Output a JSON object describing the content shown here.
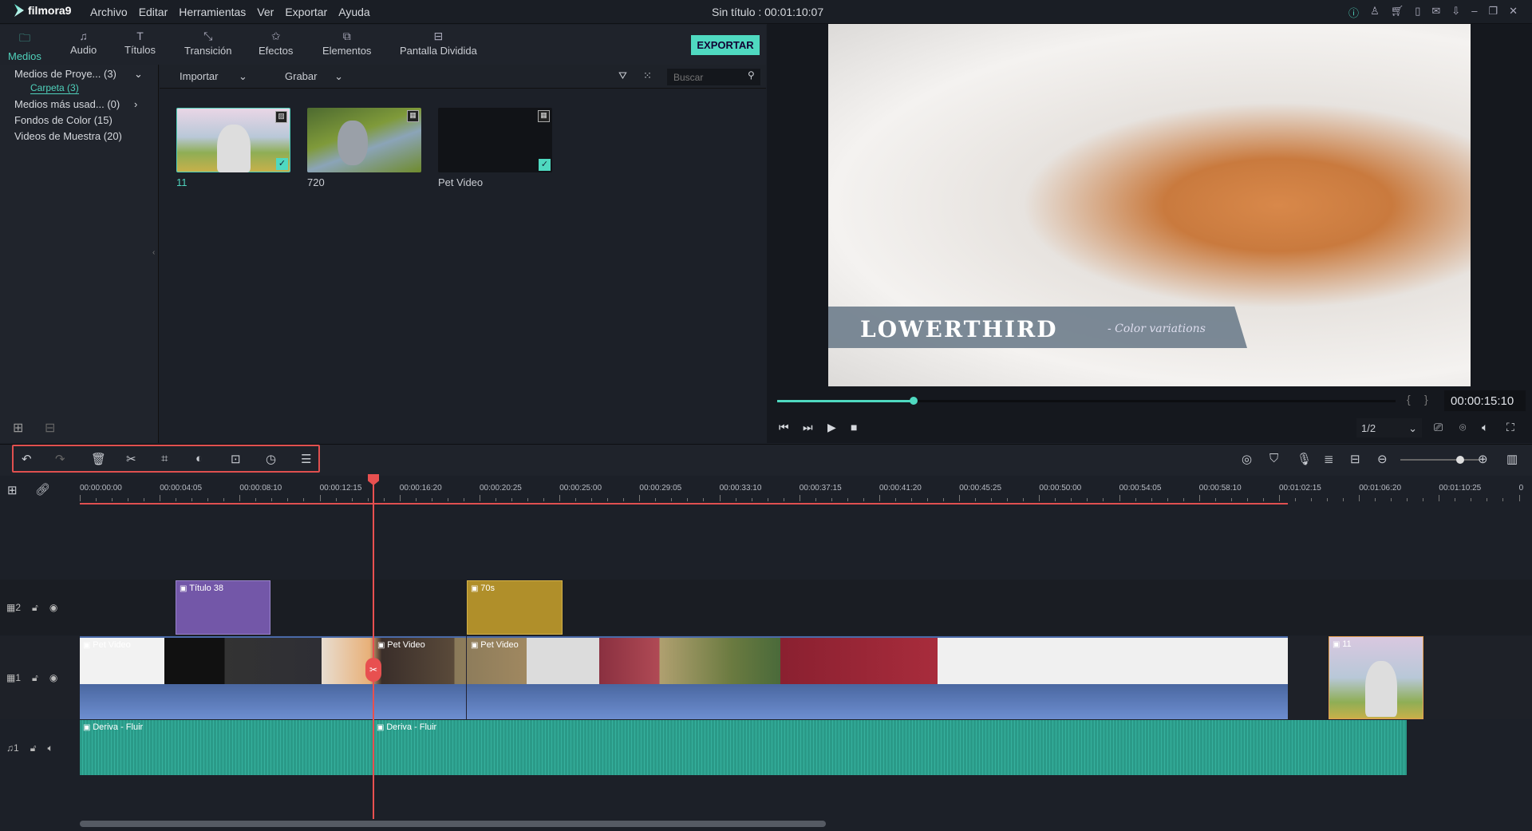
{
  "app": {
    "brand": "filmora9",
    "title": "Sin título : 00:01:10:07",
    "menu": [
      "Archivo",
      "Editar",
      "Herramientas",
      "Ver",
      "Exportar",
      "Ayuda"
    ],
    "window_icons": [
      "info-icon",
      "account-icon",
      "cart-icon",
      "save-icon",
      "mail-icon",
      "download-icon",
      "minimize-icon",
      "restore-icon",
      "close-icon"
    ]
  },
  "tabs": [
    {
      "label": "Medios",
      "icon": "folder-icon"
    },
    {
      "label": "Audio",
      "icon": "music-note-icon"
    },
    {
      "label": "Títulos",
      "icon": "text-icon"
    },
    {
      "label": "Transición",
      "icon": "transition-icon"
    },
    {
      "label": "Efectos",
      "icon": "effects-icon"
    },
    {
      "label": "Elementos",
      "icon": "elements-icon"
    },
    {
      "label": "Pantalla Dividida",
      "icon": "split-screen-icon"
    }
  ],
  "export_label": "EXPORTAR",
  "sidebar": {
    "items": [
      {
        "label": "Medios de Proye... (3)"
      },
      {
        "label": "Carpeta (3)"
      },
      {
        "label": "Medios más usad... (0)"
      },
      {
        "label": "Fondos de Color (15)"
      },
      {
        "label": "Videos de Muestra (20)"
      }
    ]
  },
  "media_toolbar": {
    "import": "Importar",
    "record": "Grabar",
    "search_placeholder": "Buscar"
  },
  "media_items": [
    {
      "name": "11",
      "selected": true
    },
    {
      "name": "720",
      "selected": false
    },
    {
      "name": "Pet Video",
      "selected": true
    }
  ],
  "preview": {
    "overlay_title": "LOWERTHIRD",
    "overlay_subtitle": "- Color variations",
    "timecode": "00:00:15:10",
    "progress_percent": 22,
    "quality": "1/2"
  },
  "timeline": {
    "ruler": [
      "00:00:00:00",
      "00:00:04:05",
      "00:00:08:10",
      "00:00:12:15",
      "00:00:16:20",
      "00:00:20:25",
      "00:00:25:00",
      "00:00:29:05",
      "00:00:33:10",
      "00:00:37:15",
      "00:00:41:20",
      "00:00:45:25",
      "00:00:50:00",
      "00:00:54:05",
      "00:00:58:10",
      "00:01:02:15",
      "00:01:06:20",
      "00:01:10:25",
      "0"
    ],
    "tracks": [
      {
        "label": "2"
      },
      {
        "label": "1"
      },
      {
        "label": "1"
      }
    ],
    "clips": {
      "title38": "Título 38",
      "seventies": "70s",
      "pet1": "Pet Video",
      "pet2": "Pet Video",
      "pet3": "Pet Video",
      "img11": "11",
      "audio1": "Deriva - Fluir",
      "audio2": "Deriva - Fluir"
    },
    "zoom_level_percent": 75,
    "colors": {
      "title_clip": "#7357a8",
      "effect_clip": "#b08f2a",
      "audio_clip": "#2a9a88",
      "playhead": "#e85050",
      "accent": "#4fd9c0"
    }
  }
}
